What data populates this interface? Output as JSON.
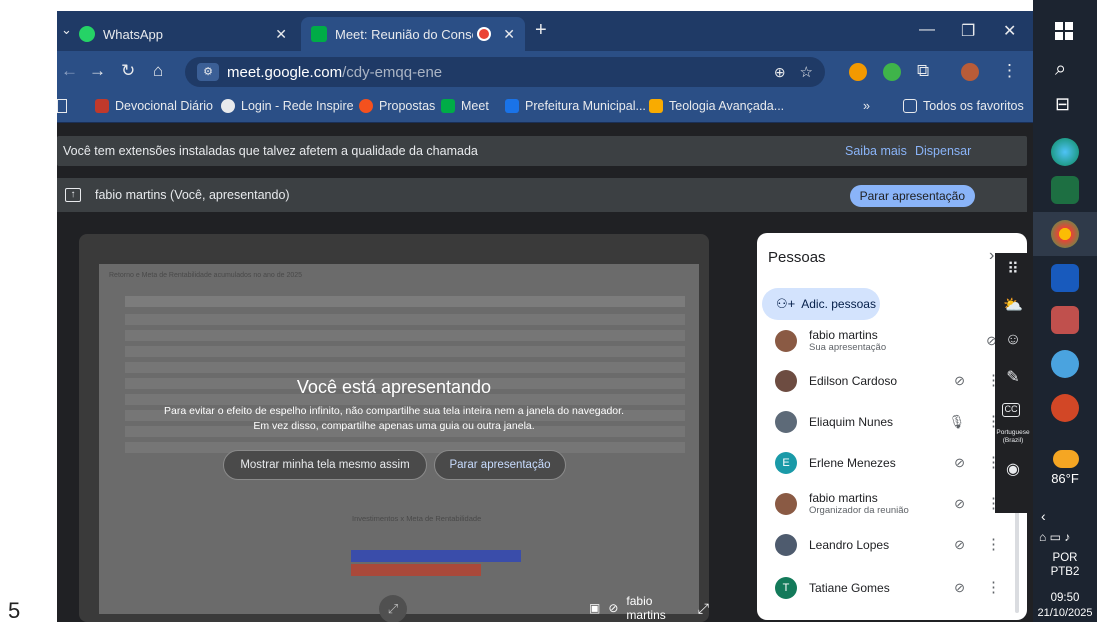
{
  "page_number": "5",
  "browser": {
    "tabs": [
      {
        "label": "WhatsApp",
        "active": false
      },
      {
        "label": "Meet: Reunião do Conselho",
        "active": true
      }
    ],
    "new_tab": "+",
    "url_host": "meet.google.com",
    "url_path": "/cdy-emqq-ene",
    "bookmarks": [
      "Devocional Diário",
      "Login - Rede Inspire",
      "Propostas",
      "Meet",
      "Prefeitura Municipal...",
      "Teologia Avançada..."
    ],
    "bookmarks_more": "»",
    "all_bookmarks": "Todos os favoritos"
  },
  "meet": {
    "extensions_banner": "Você tem extensões instaladas que talvez afetem a qualidade da chamada",
    "learn_more": "Saiba mais",
    "dismiss": "Dispensar",
    "presenting_label": "fabio martins (Você, apresentando)",
    "stop_presenting": "Parar apresentação",
    "shared_screen": {
      "title": "Retorno e Meta de Rentabilidade acumulados no ano de 2025",
      "chart_title": "Investimentos x Meta de Rentabilidade"
    },
    "overlay_title": "Você está apresentando",
    "overlay_sub": "Para evitar o efeito de espelho infinito, não compartilhe sua tela inteira nem a janela do navegador. Em vez disso, compartilhe apenas uma guia ou outra janela.",
    "show_screen_button": "Mostrar minha tela mesmo assim",
    "stop_button": "Parar apresentação",
    "tile_name": "fabio martins",
    "caption_lang": "Portuguese (Brazil)"
  },
  "people": {
    "title": "Pessoas",
    "add_button": "Adic. pessoas",
    "participants": [
      {
        "name": "fabio martins",
        "role": "Sua apresentação",
        "initial": "",
        "color": "#8a5a44",
        "mic": "presenting"
      },
      {
        "name": "Edilson Cardoso",
        "role": "",
        "initial": "",
        "color": "#6d4c41",
        "mic": "muted"
      },
      {
        "name": "Eliaquim Nunes",
        "role": "",
        "initial": "",
        "color": "#5d6a78",
        "mic": "on"
      },
      {
        "name": "Erlene Menezes",
        "role": "",
        "initial": "E",
        "color": "#1a9aa8",
        "mic": "muted"
      },
      {
        "name": "fabio martins",
        "role": "Organizador da reunião",
        "initial": "",
        "color": "#8a5a44",
        "mic": "muted"
      },
      {
        "name": "Leandro Lopes",
        "role": "",
        "initial": "",
        "color": "#4e5b6e",
        "mic": "muted"
      },
      {
        "name": "Tatiane Gomes",
        "role": "",
        "initial": "T",
        "color": "#137a5a",
        "mic": "muted"
      }
    ]
  },
  "taskbar": {
    "weather": "86°F",
    "language_1": "POR",
    "language_2": "PTB2",
    "time": "09:50",
    "date": "21/10/2025"
  }
}
